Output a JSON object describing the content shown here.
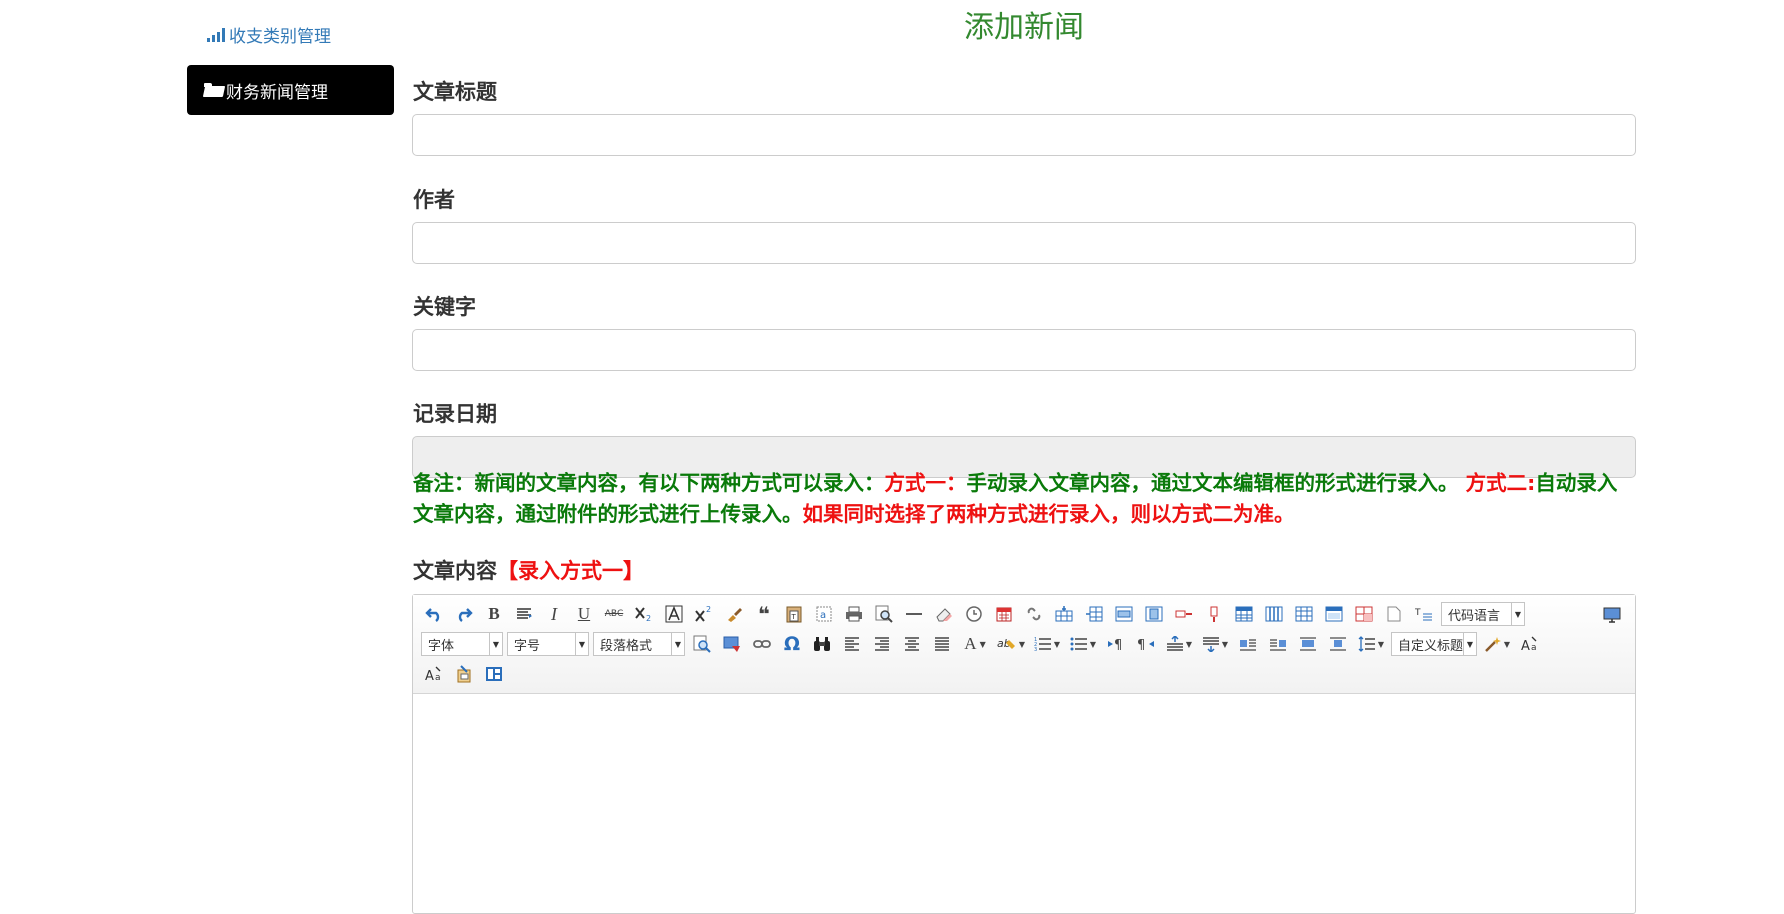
{
  "sidebar": {
    "link_label": "收支类别管理",
    "active_label": "财务新闻管理"
  },
  "page": {
    "title": "添加新闻"
  },
  "form": {
    "title_label": "文章标题",
    "author_label": "作者",
    "keyword_label": "关键字",
    "date_label": "记录日期",
    "title_value": "",
    "author_value": "",
    "keyword_value": "",
    "date_value": ""
  },
  "note": {
    "part1": "备注：新闻的文章内容，有以下两种方式可以录入：",
    "part2": "方式一：",
    "part3": "手动录入文章内容，通过文本编辑框的形式进行录入。",
    "part4": " 方式二:",
    "part5": "自动录入文章内容，通过附件的形式进行上传录入。",
    "part6": "如果同时选择了两种方式进行录入，则以方式二为准。"
  },
  "content": {
    "label": "文章内容",
    "method": "【录入方式一】"
  },
  "editor": {
    "code_lang": "代码语言",
    "font_family": "字体",
    "font_size": "字号",
    "paragraph": "段落格式",
    "custom_title": "自定义标题",
    "glyphs": {
      "bold": "B",
      "italic": "I",
      "underline": "U",
      "strike": "ABC",
      "quote": "❝",
      "omega": "Ω",
      "fontcolor": "A"
    },
    "colors": {
      "blue": "#2a6ebb",
      "toolbar_bg": "#f2f2f2"
    }
  },
  "colors": {
    "title_green": "#33892f",
    "note_green": "#0a7a0a",
    "note_red": "#ee1111",
    "link_blue": "#337ab7"
  }
}
